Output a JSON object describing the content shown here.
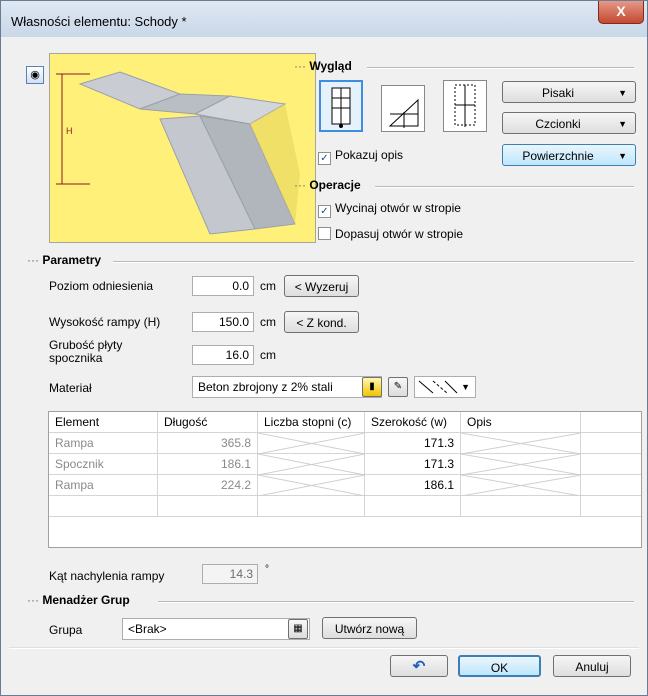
{
  "window": {
    "title": "Własności elementu: Schody *",
    "close_label": "X"
  },
  "wyglad": {
    "header": "Wygląd",
    "buttons": {
      "pisaki": "Pisaki",
      "czcionki": "Czcionki",
      "powierzchnie": "Powierzchnie"
    },
    "pokazuj_opis": {
      "label": "Pokazuj opis",
      "checked": true
    }
  },
  "operacje": {
    "header": "Operacje",
    "wycinaj": {
      "label": "Wycinaj otwór w stropie",
      "checked": true
    },
    "dopasuj": {
      "label": "Dopasuj otwór w stropie",
      "checked": false
    }
  },
  "parametry": {
    "header": "Parametry",
    "poziom": {
      "label": "Poziom odniesienia",
      "value": "0.0",
      "unit": "cm",
      "button": "< Wyzeruj"
    },
    "wysokosc": {
      "label": "Wysokość rampy (H)",
      "value": "150.0",
      "unit": "cm",
      "button": "< Z kond."
    },
    "grubosc": {
      "label_line1": "Grubość płyty",
      "label_line2": "spocznika",
      "value": "16.0",
      "unit": "cm"
    },
    "material": {
      "label": "Materiał",
      "value": "Beton zbrojony z 2% stali"
    }
  },
  "preview": {
    "h_label": "H"
  },
  "table": {
    "columns": [
      "Element",
      "Długość",
      "Liczba stopni (c)",
      "Szerokość (w)",
      "Opis"
    ],
    "rows": [
      {
        "element": "Rampa",
        "dlugosc": "365.8",
        "szerokosc": "171.3"
      },
      {
        "element": "Spocznik",
        "dlugosc": "186.1",
        "szerokosc": "171.3"
      },
      {
        "element": "Rampa",
        "dlugosc": "224.2",
        "szerokosc": "186.1"
      }
    ]
  },
  "kat": {
    "label": "Kąt nachylenia rampy",
    "value": "14.3",
    "unit": "°"
  },
  "menadzer": {
    "header": "Menadżer Grup",
    "grupa_label": "Grupa",
    "grupa_value": "<Brak>",
    "utworz": "Utwórz nową"
  },
  "footer": {
    "ok": "OK",
    "anuluj": "Anuluj"
  }
}
